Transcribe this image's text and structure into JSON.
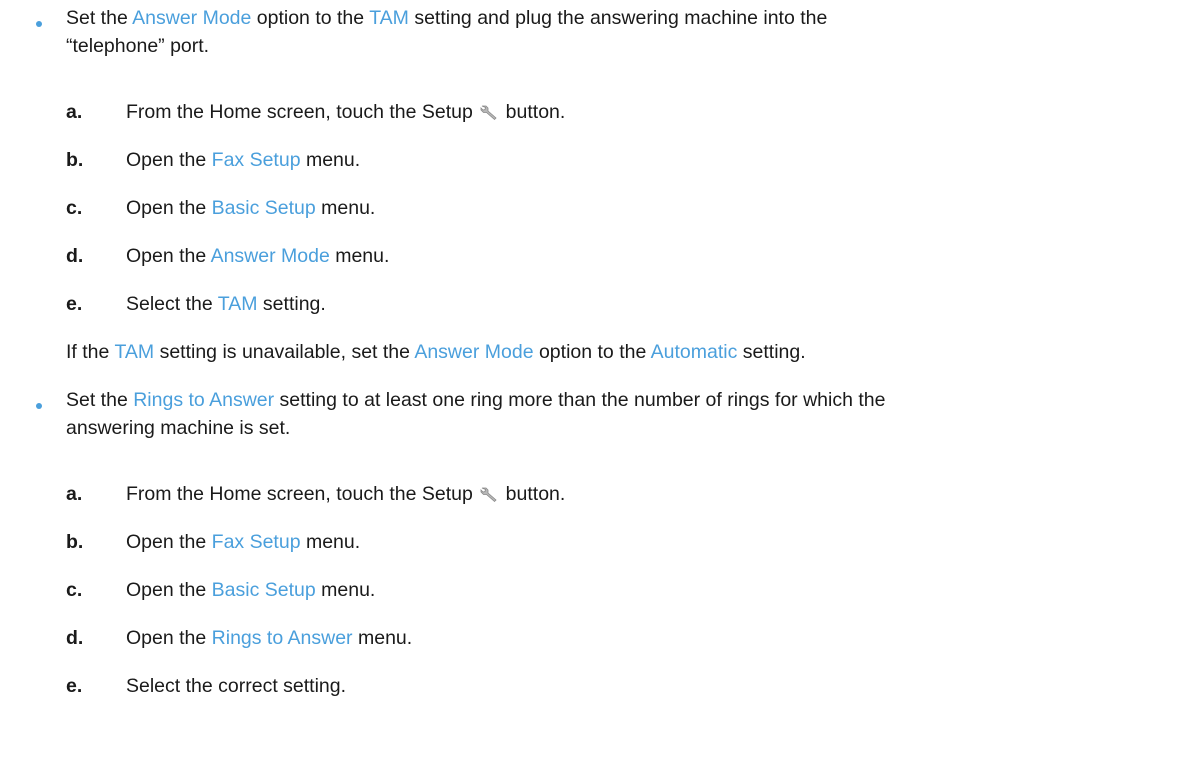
{
  "bullet1": {
    "text": {
      "p1": "Set the ",
      "h1": "Answer Mode",
      "p2": " option to the ",
      "h2": "TAM",
      "p3": " setting and plug the answering machine into the",
      "line2": "“telephone” port."
    },
    "steps": [
      {
        "letter": "a.",
        "pre": "From the Home screen, touch the Setup ",
        "post": " button."
      },
      {
        "letter": "b.",
        "pre": "Open the ",
        "hl": "Fax Setup",
        "post": " menu."
      },
      {
        "letter": "c.",
        "pre": "Open the ",
        "hl": "Basic Setup",
        "post": " menu."
      },
      {
        "letter": "d.",
        "pre": "Open the ",
        "hl": "Answer Mode",
        "post": " menu."
      },
      {
        "letter": "e.",
        "pre": "Select the ",
        "hl": "TAM",
        "post": " setting."
      }
    ],
    "note": {
      "p1": "If the ",
      "h1": "TAM",
      "p2": " setting is unavailable, set the ",
      "h2": "Answer Mode",
      "p3": " option to the ",
      "h3": "Automatic",
      "p4": " setting."
    }
  },
  "bullet2": {
    "text": {
      "p1": "Set the ",
      "h1": "Rings to Answer",
      "p2": " setting to at least one ring more than the number of rings for which the",
      "line2": "answering machine is set."
    },
    "steps": [
      {
        "letter": "a.",
        "pre": "From the Home screen, touch the Setup ",
        "post": " button."
      },
      {
        "letter": "b.",
        "pre": "Open the ",
        "hl": "Fax Setup",
        "post": " menu."
      },
      {
        "letter": "c.",
        "pre": "Open the ",
        "hl": "Basic Setup",
        "post": " menu."
      },
      {
        "letter": "d.",
        "pre": "Open the ",
        "hl": "Rings to Answer",
        "post": " menu."
      },
      {
        "letter": "e.",
        "pre": "Select the correct setting."
      }
    ]
  },
  "icons": {
    "setup": "wrench-icon"
  },
  "colors": {
    "highlight": "#4a9fdc",
    "bullet": "#4a9fdc",
    "text": "#1a1a1a"
  }
}
